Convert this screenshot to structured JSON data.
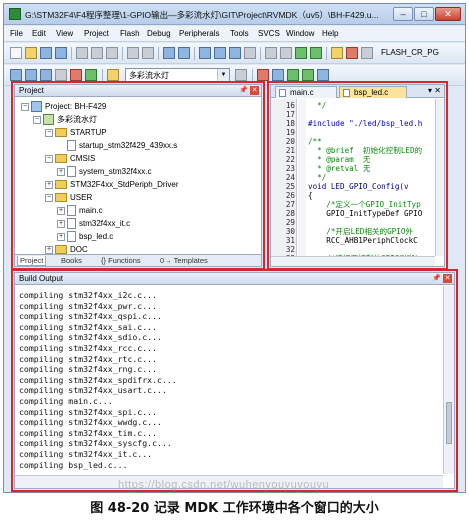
{
  "window": {
    "title": "G:\\STM32F4\\F4程序整理\\1-GPIO输出—多彩流水灯\\GIT\\Project\\RVMDK（uv5）\\BH-F429.u...",
    "controls": {
      "minimize": "–",
      "maximize": "□",
      "close": "✕"
    }
  },
  "menu": [
    "File",
    "Edit",
    "View",
    "Project",
    "Flash",
    "Debug",
    "Peripherals",
    "Tools",
    "SVCS",
    "Window",
    "Help"
  ],
  "toolbar": {
    "flash_target": "FLASH_CR_PG",
    "target_select": "多彩流水灯"
  },
  "project_panel": {
    "title": "Project",
    "pin": "📌",
    "close": "✕",
    "tree": [
      {
        "label": "Project: BH-F429",
        "toggle": "−",
        "kind": "project"
      },
      {
        "label": "多彩流水灯",
        "toggle": "−",
        "kind": "target"
      },
      {
        "label": "STARTUP",
        "toggle": "−",
        "kind": "folder"
      },
      {
        "label": "startup_stm32f429_439xx.s",
        "toggle": "",
        "kind": "file"
      },
      {
        "label": "CMSIS",
        "toggle": "−",
        "kind": "folder"
      },
      {
        "label": "system_stm32f4xx.c",
        "toggle": "+",
        "kind": "file"
      },
      {
        "label": "STM32F4xx_StdPeriph_Driver",
        "toggle": "+",
        "kind": "folder"
      },
      {
        "label": "USER",
        "toggle": "−",
        "kind": "folder"
      },
      {
        "label": "main.c",
        "toggle": "+",
        "kind": "file"
      },
      {
        "label": "stm32f4xx_it.c",
        "toggle": "+",
        "kind": "file"
      },
      {
        "label": "bsp_led.c",
        "toggle": "+",
        "kind": "file"
      },
      {
        "label": "DOC",
        "toggle": "+",
        "kind": "folder"
      }
    ],
    "tabs": [
      "Project",
      "Books",
      "{} Functions",
      "0→ Templates"
    ]
  },
  "editor": {
    "tabs": [
      "main.c",
      "bsp_led.c"
    ],
    "active_tab": "bsp_led.c",
    "lines": [
      {
        "n": "16",
        "text": "  */",
        "cls": "c-cmt"
      },
      {
        "n": "17",
        "text": "",
        "cls": ""
      },
      {
        "n": "18",
        "text": "#include \"./led/bsp_led.h",
        "cls": "c-dir"
      },
      {
        "n": "19",
        "text": "",
        "cls": ""
      },
      {
        "n": "20",
        "text": "/**",
        "cls": "c-cmt"
      },
      {
        "n": "21",
        "text": "  * @brief  初始化控制LED的",
        "cls": "c-cmt"
      },
      {
        "n": "22",
        "text": "  * @param  无",
        "cls": "c-cmt"
      },
      {
        "n": "23",
        "text": "  * @retval 无",
        "cls": "c-cmt"
      },
      {
        "n": "24",
        "text": "  */",
        "cls": "c-cmt"
      },
      {
        "n": "25",
        "text": "void LED_GPIO_Config(v",
        "cls": "c-kw"
      },
      {
        "n": "26",
        "text": "{",
        "cls": ""
      },
      {
        "n": "27",
        "text": "    /*定义一个GPIO_InitTyp",
        "cls": "c-cmt"
      },
      {
        "n": "28",
        "text": "    GPIO_InitTypeDef GPIO",
        "cls": ""
      },
      {
        "n": "29",
        "text": "",
        "cls": ""
      },
      {
        "n": "30",
        "text": "    /*开启LED相关的GPIO外",
        "cls": "c-cmt"
      },
      {
        "n": "31",
        "text": "    RCC_AHB1PeriphClockC",
        "cls": ""
      },
      {
        "n": "32",
        "text": "",
        "cls": ""
      },
      {
        "n": "33",
        "text": "    /*选择要控制的GPIO引脚*",
        "cls": "c-cmt"
      }
    ]
  },
  "build_output": {
    "title": "Build Output",
    "lines": [
      "compiling stm32f4xx_i2c.c...",
      "compiling stm32f4xx_pwr.c...",
      "compiling stm32f4xx_qspi.c...",
      "compiling stm32f4xx_sai.c...",
      "compiling stm32f4xx_sdio.c...",
      "compiling stm32f4xx_rcc.c...",
      "compiling stm32f4xx_rtc.c...",
      "compiling stm32f4xx_rng.c...",
      "compiling stm32f4xx_spdifrx.c...",
      "compiling stm32f4xx_usart.c...",
      "compiling main.c...",
      "compiling stm32f4xx_spi.c...",
      "compiling stm32f4xx_wwdg.c...",
      "compiling stm32f4xx_tim.c...",
      "compiling stm32f4xx_syscfg.c...",
      "compiling stm32f4xx_it.c...",
      "compiling bsp_led.c..."
    ]
  },
  "watermark": "https://blog.csdn.net/wuhenyouyuyouyu",
  "caption": "图 48-20 记录 MDK 工作环境中各个窗口的大小",
  "colors": {
    "highlight": "#d9262c",
    "active_tab": "#fbe39a",
    "comment": "#0b8a0b"
  }
}
